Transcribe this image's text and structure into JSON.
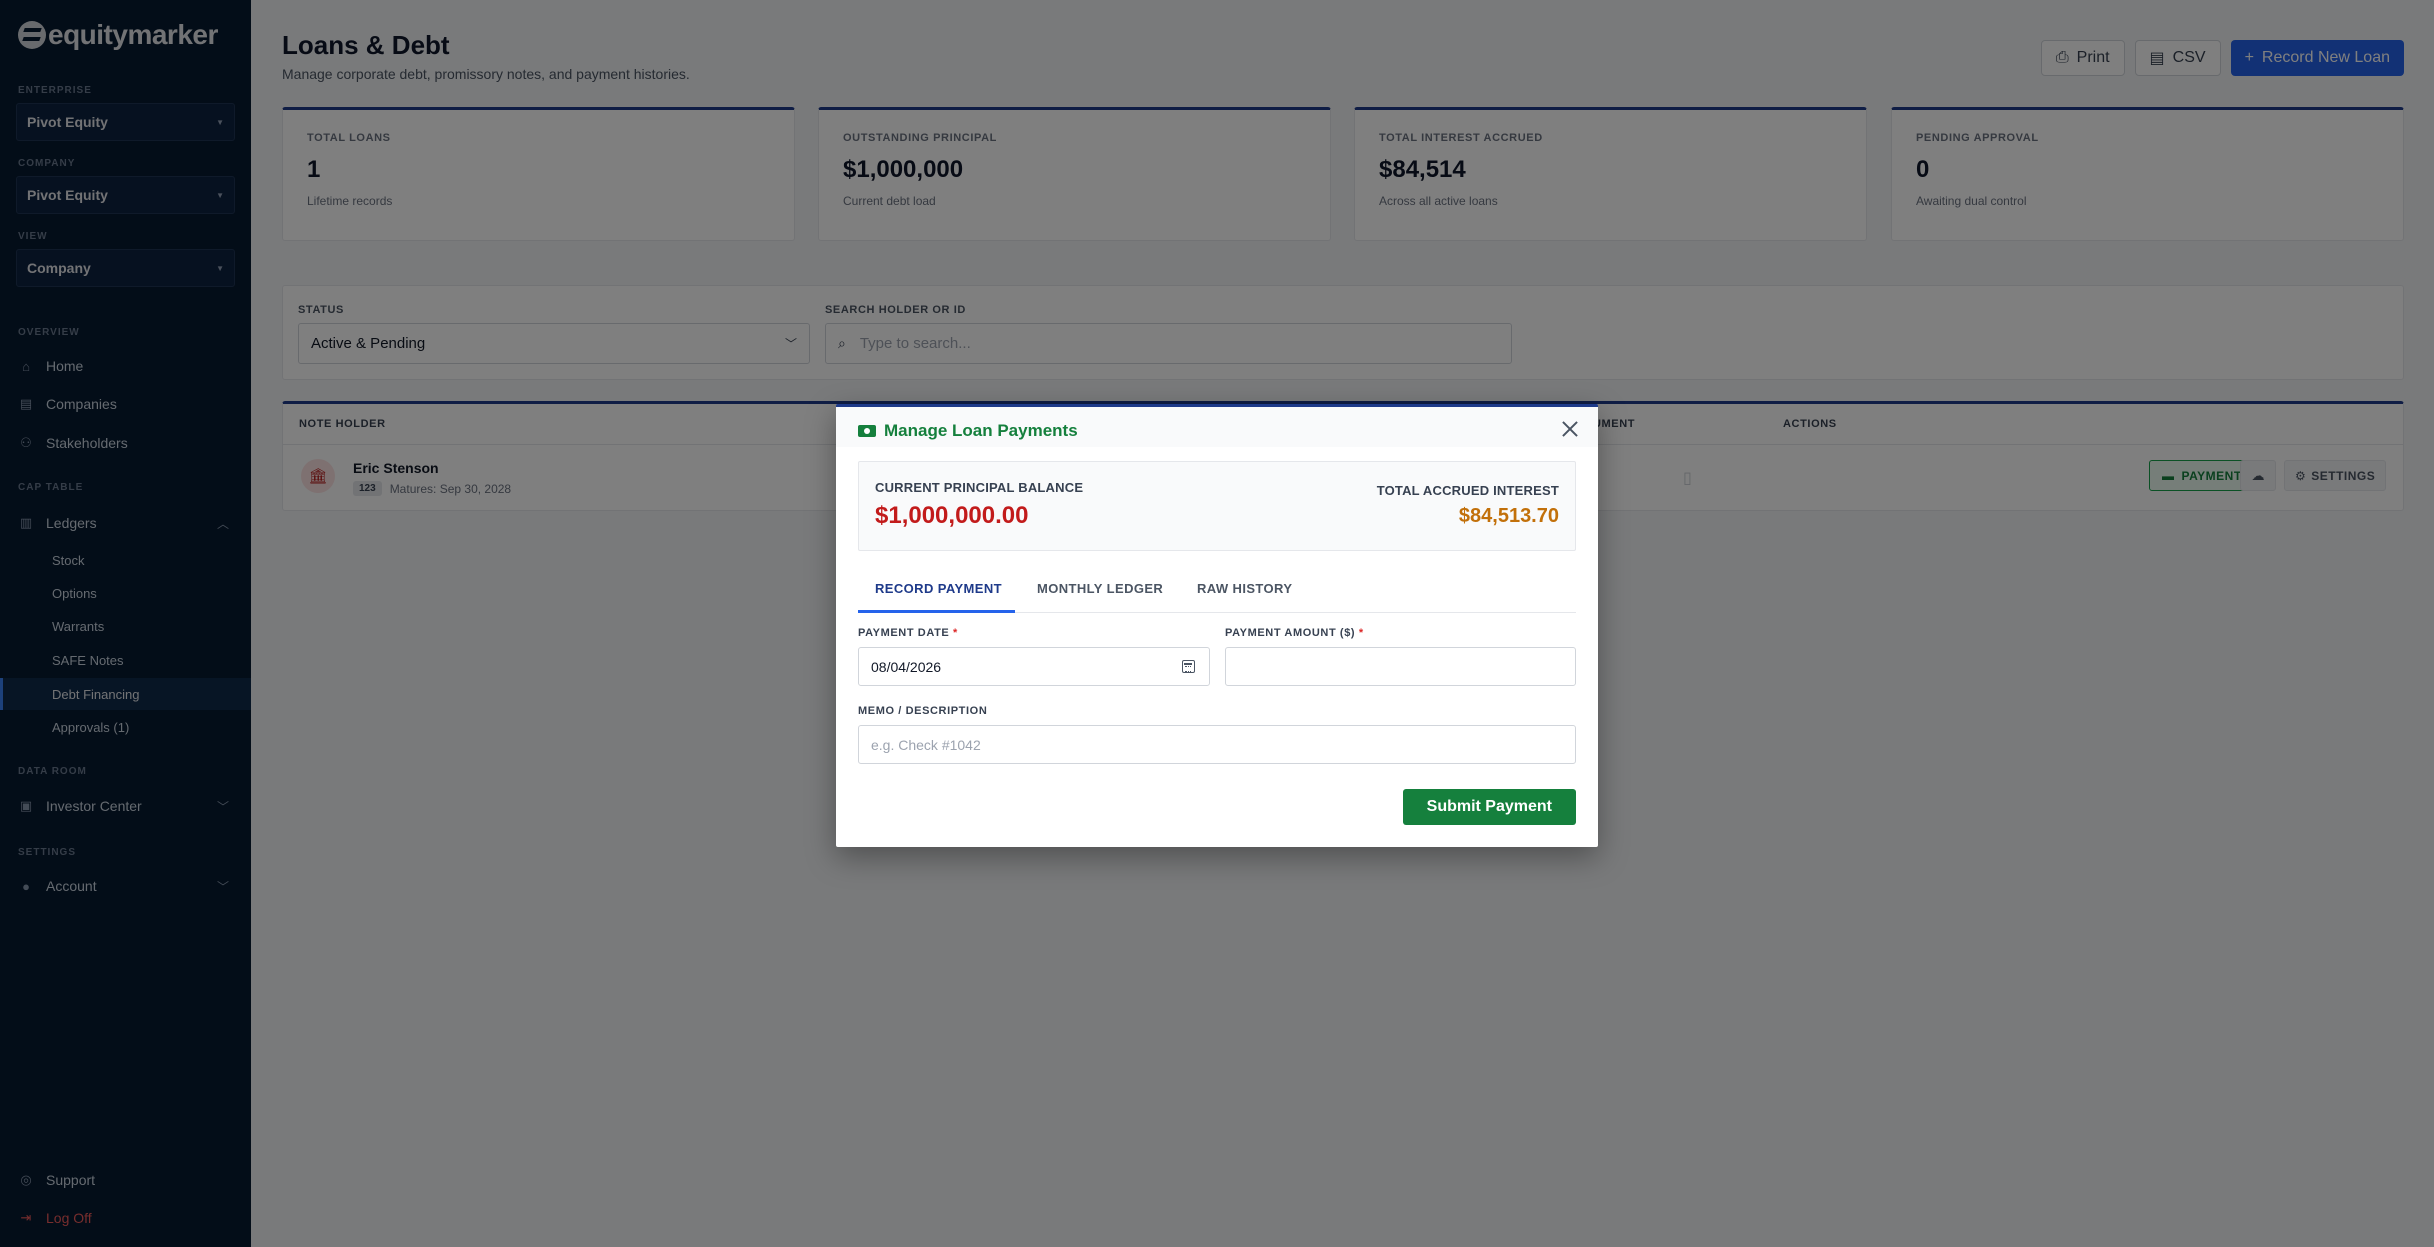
{
  "brand": {
    "name": "equitymarker"
  },
  "sidebar": {
    "enterprise_label": "ENTERPRISE",
    "enterprise_value": "Pivot Equity",
    "company_label": "COMPANY",
    "company_value": "Pivot Equity",
    "view_label": "VIEW",
    "view_value": "Company",
    "overview_label": "OVERVIEW",
    "home": "Home",
    "companies": "Companies",
    "stakeholders": "Stakeholders",
    "cap_table_label": "CAP TABLE",
    "ledgers": "Ledgers",
    "ledger_items": [
      "Stock",
      "Options",
      "Warrants",
      "SAFE Notes",
      "Debt Financing",
      "Approvals (1)"
    ],
    "data_room_label": "DATA ROOM",
    "investor_center": "Investor Center",
    "settings_label": "SETTINGS",
    "account": "Account",
    "support": "Support",
    "log_off": "Log Off"
  },
  "header": {
    "title": "Loans & Debt",
    "subtitle": "Manage corporate debt, promissory notes, and payment histories.",
    "print_label": "Print",
    "csv_label": "CSV",
    "record_label": "Record New Loan"
  },
  "stats": [
    {
      "label": "TOTAL LOANS",
      "value": "1",
      "desc": "Lifetime records"
    },
    {
      "label": "OUTSTANDING PRINCIPAL",
      "value": "$1,000,000",
      "desc": "Current debt load"
    },
    {
      "label": "TOTAL INTEREST ACCRUED",
      "value": "$84,514",
      "desc": "Across all active loans"
    },
    {
      "label": "PENDING APPROVAL",
      "value": "0",
      "desc": "Awaiting dual control"
    }
  ],
  "filters": {
    "status_label": "STATUS",
    "status_value": "Active & Pending",
    "search_label": "SEARCH HOLDER OR ID",
    "search_placeholder": "Type to search..."
  },
  "table": {
    "columns": {
      "holder": "NOTE HOLDER",
      "document": "UMENT",
      "actions": "ACTIONS"
    },
    "rows": [
      {
        "name": "Eric Stenson",
        "badge": "123",
        "maturity": "Matures: Sep 30, 2028"
      }
    ],
    "payments_btn": "PAYMENTS",
    "settings_btn": "SETTINGS"
  },
  "modal": {
    "title": "Manage Loan Payments",
    "principal_label": "CURRENT PRINCIPAL BALANCE",
    "principal_value": "$1,000,000.00",
    "interest_label": "TOTAL ACCRUED INTEREST",
    "interest_value": "$84,513.70",
    "tabs": [
      "RECORD PAYMENT",
      "MONTHLY LEDGER",
      "RAW HISTORY"
    ],
    "date_label": "PAYMENT DATE",
    "date_value": "08/04/2026",
    "amount_label": "PAYMENT AMOUNT ($)",
    "amount_value": "",
    "memo_label": "MEMO / DESCRIPTION",
    "memo_placeholder": "e.g. Check #1042",
    "required_mark": "*",
    "submit_label": "Submit Payment"
  },
  "colors": {
    "sidebar_bg": "#071a30",
    "primary": "#2563eb",
    "success": "#15803d",
    "danger": "#c21b1b",
    "warning": "#c2700a"
  }
}
